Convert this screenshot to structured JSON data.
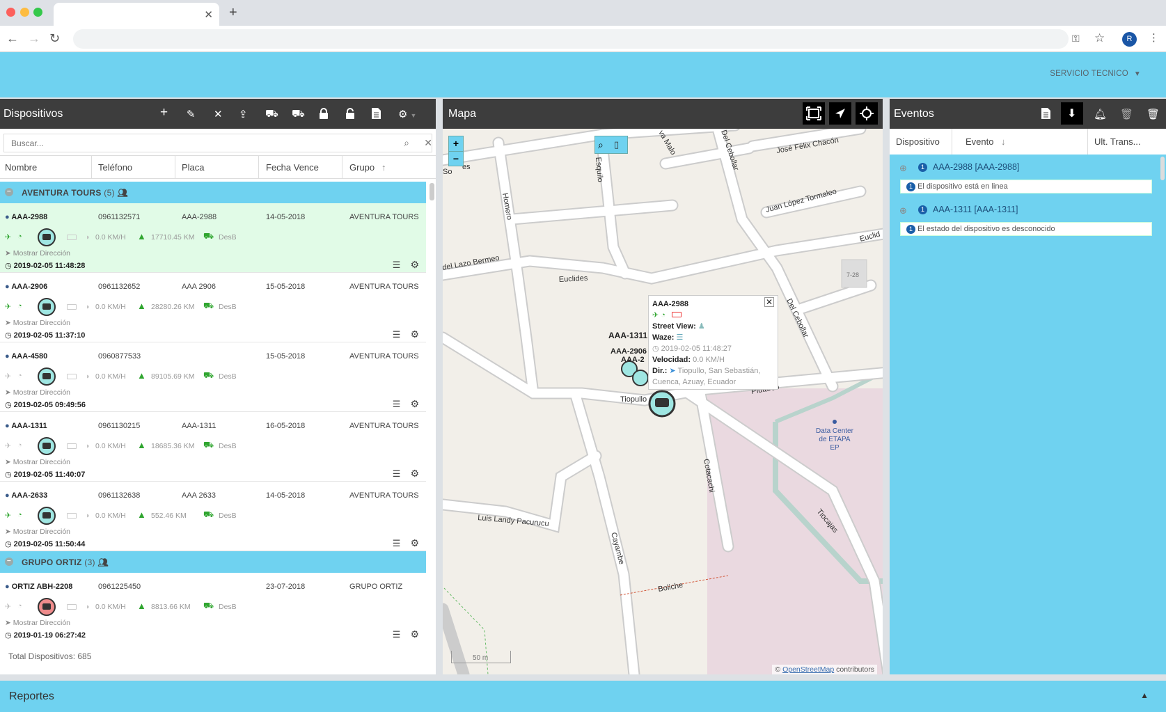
{
  "header": {
    "user_menu": "SERVICIO TECNICO"
  },
  "left": {
    "title": "Dispositivos",
    "search_placeholder": "Buscar...",
    "columns": [
      "Nombre",
      "Teléfono",
      "Placa",
      "Fecha Vence",
      "Grupo"
    ],
    "groups": [
      {
        "name": "AVENTURA TOURS",
        "count": "(5)",
        "devices": [
          {
            "name": "AAA-2988",
            "phone": "0961132571",
            "plate": "AAA-2988",
            "expires": "14-05-2018",
            "group": "AVENTURA TOURS",
            "speed": "0.0 KM/H",
            "odo": "17710.45 KM",
            "des": "DesB",
            "dir": "Mostrar Dirección",
            "date": "2019-02-05 11:48:28",
            "selected": true,
            "status": "online",
            "bus": "cyan"
          },
          {
            "name": "AAA-2906",
            "phone": "0961132652",
            "plate": "AAA 2906",
            "expires": "15-05-2018",
            "group": "AVENTURA TOURS",
            "speed": "0.0 KM/H",
            "odo": "28280.26 KM",
            "des": "DesB",
            "dir": "Mostrar Dirección",
            "date": "2019-02-05 11:37:10",
            "selected": false,
            "status": "online",
            "bus": "cyan"
          },
          {
            "name": "AAA-4580",
            "phone": "0960877533",
            "plate": "",
            "expires": "15-05-2018",
            "group": "AVENTURA TOURS",
            "speed": "0.0 KM/H",
            "odo": "89105.69 KM",
            "des": "DesB",
            "dir": "Mostrar Dirección",
            "date": "2019-02-05 09:49:56",
            "selected": false,
            "status": "offline",
            "bus": "cyan"
          },
          {
            "name": "AAA-1311",
            "phone": "0961130215",
            "plate": "AAA-1311",
            "expires": "16-05-2018",
            "group": "AVENTURA TOURS",
            "speed": "0.0 KM/H",
            "odo": "18685.36 KM",
            "des": "DesB",
            "dir": "Mostrar Dirección",
            "date": "2019-02-05 11:40:07",
            "selected": false,
            "status": "offline",
            "bus": "cyan"
          },
          {
            "name": "AAA-2633",
            "phone": "0961132638",
            "plate": "AAA 2633",
            "expires": "14-05-2018",
            "group": "AVENTURA TOURS",
            "speed": "0.0 KM/H",
            "odo": "552.46 KM",
            "des": "DesB",
            "dir": "Mostrar Dirección",
            "date": "2019-02-05 11:50:44",
            "selected": false,
            "status": "online",
            "bus": "cyan"
          }
        ]
      },
      {
        "name": "GRUPO ORTIZ",
        "count": "(3)",
        "devices": [
          {
            "name": "ORTIZ ABH-2208",
            "phone": "0961225450",
            "plate": "",
            "expires": "23-07-2018",
            "group": "GRUPO ORTIZ",
            "speed": "0.0 KM/H",
            "odo": "8813.66 KM",
            "des": "DesB",
            "dir": "Mostrar Dirección",
            "date": "2019-01-19 06:27:42",
            "selected": false,
            "status": "offline",
            "bus": "red"
          }
        ]
      }
    ],
    "total": "Total Dispositivos: 685"
  },
  "map": {
    "title": "Mapa",
    "streets": [
      "José Félix Chacón",
      "Juan López Tormaleo",
      "Euclides",
      "Euclid",
      "del Lazo Bermeo",
      "Homero",
      "Esquilo",
      "Del Cebollar",
      "Del Cebollar",
      "Tiopullo",
      "Plutarco",
      "Cotacachi",
      "Cayambe",
      "Luis Landy Pacurucu",
      "Boliche",
      "Tiocajas",
      "va Malo",
      "So",
      "es",
      "7-28"
    ],
    "poi": [
      "Data Center",
      "de ETAPA",
      "EP"
    ],
    "markers": [
      "AAA-1311",
      "AAA-2906",
      "AAA-2"
    ],
    "popup": {
      "name": "AAA-2988",
      "street_view": "Street View:",
      "waze": "Waze:",
      "date": "2019-02-05 11:48:27",
      "vel_label": "Velocidad:",
      "vel": "0.0 KM/H",
      "dir_label": "Dir.:",
      "dir_line1": "Tiopullo, San Sebastián,",
      "dir_line2": "Cuenca, Azuay, Ecuador"
    },
    "scale": "50 m",
    "attribution_prefix": "©",
    "attribution_link": "OpenStreetMap",
    "attribution_suffix": "contributors"
  },
  "events": {
    "title": "Eventos",
    "columns": [
      "Dispositivo",
      "Evento",
      "Ult. Trans..."
    ],
    "items": [
      {
        "count": "1",
        "title": "AAA-2988 [AAA-2988]",
        "msg_count": "1",
        "msg": "El dispositivo está en linea"
      },
      {
        "count": "1",
        "title": "AAA-1311 [AAA-1311]",
        "msg_count": "1",
        "msg": "El estado del dispositivo es desconocido"
      }
    ]
  },
  "footer": {
    "reportes": "Reportes"
  },
  "colors": {
    "accent": "#6fd2f0",
    "header_dark": "#3d3d3d",
    "selected_row": "#e1fbe7",
    "online_green": "#2fa52f"
  }
}
